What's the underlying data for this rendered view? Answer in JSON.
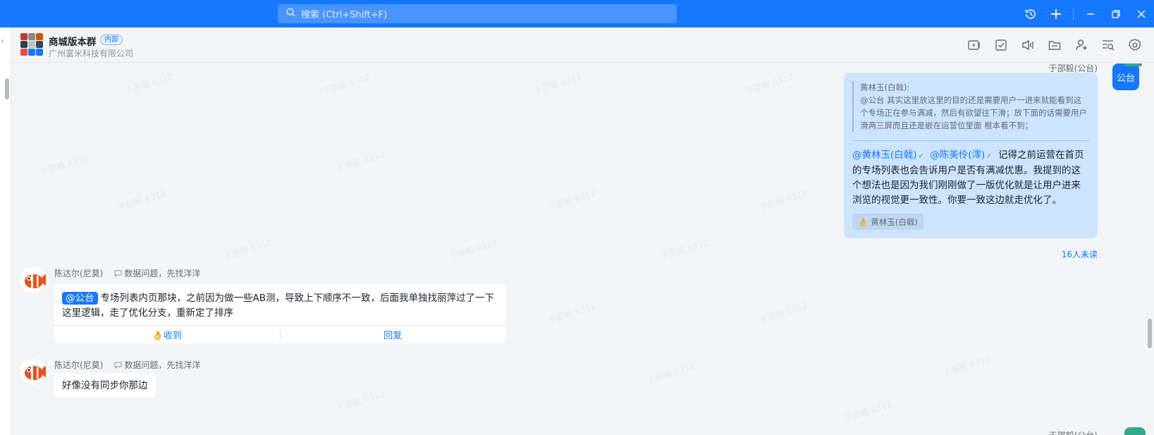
{
  "colors": {
    "accent": "#1677ff",
    "bubble_right": "#cce4ff",
    "success": "#31a98f"
  },
  "search": {
    "placeholder": "搜索 (Ctrl+Shift+F)"
  },
  "titlebar": {
    "icons": [
      "history-icon",
      "plus-icon",
      "minimize-icon",
      "restore-icon",
      "close-icon"
    ]
  },
  "header": {
    "group_name": "商城版本群",
    "badge": "内部",
    "company": "广州富米科技有限公司",
    "tools": [
      "video-meeting-icon",
      "task-icon",
      "voice-icon",
      "folder-icon",
      "add-member-icon",
      "search-messages-icon",
      "settings-icon"
    ]
  },
  "watermark": "于邵毅 6312",
  "messages": {
    "right": {
      "sender": "于邵毅(公台)",
      "avatar_text": "公台",
      "quote_author": "黄林玉(白戟):",
      "quote_text": "@公台  其实这里放这里的目的还是需要用户一进来就能看到这个专场正在参与满减，然后有欲望往下滑；放下面的话需要用户滑两三屏而且还是嵌在运营位里面 根本看不到；",
      "mention1": "@黄林玉(白戟)",
      "mention2": "@陈美伶(澪)",
      "body": "记得之前运营在首页的专场列表也会告诉用户是否有满减优惠。我提到的这个想法也是因为我们刚刚做了一版优化就是让用户进来浏览的视觉更一致性。你要一致这边就走优化了。",
      "reaction": "黄林玉(白戟)",
      "unread": "16人未读"
    },
    "left1": {
      "sender": "陈达尔(尼莫)",
      "signature": "数据问题，先找洋洋",
      "at": "@公台",
      "body": "专场列表内页那块，之前因为做一些AB测，导致上下顺序不一致，后面我单独找丽萍过了一下这里逻辑，走了优化分支，重新定了排序",
      "ack": "收到",
      "reply": "回复"
    },
    "left2": {
      "sender": "陈达尔(尼莫)",
      "signature": "数据问题，先找洋洋",
      "body": "好像没有同步你那边"
    },
    "bottom_sender": "于邵毅(公台)"
  }
}
